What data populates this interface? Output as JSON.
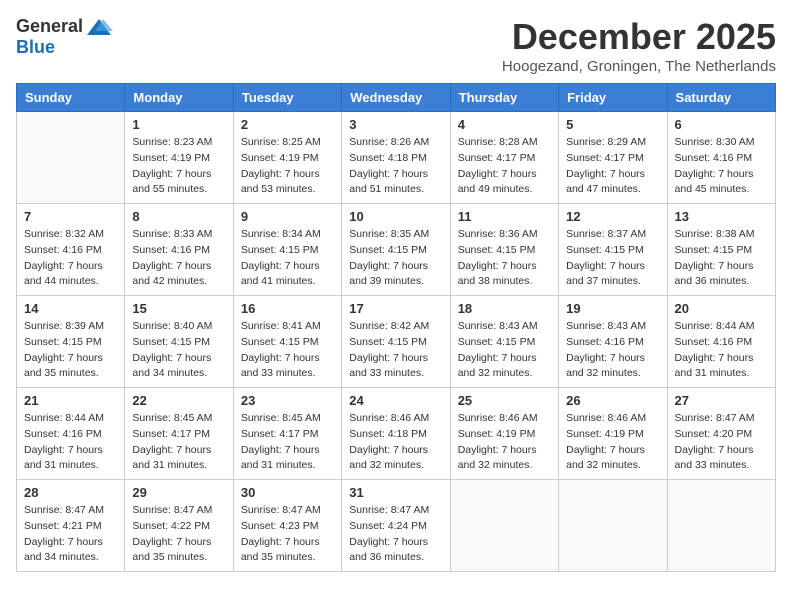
{
  "logo": {
    "general": "General",
    "blue": "Blue"
  },
  "header": {
    "month": "December 2025",
    "location": "Hoogezand, Groningen, The Netherlands"
  },
  "weekdays": [
    "Sunday",
    "Monday",
    "Tuesday",
    "Wednesday",
    "Thursday",
    "Friday",
    "Saturday"
  ],
  "weeks": [
    [
      {
        "day": "",
        "detail": ""
      },
      {
        "day": "1",
        "detail": "Sunrise: 8:23 AM\nSunset: 4:19 PM\nDaylight: 7 hours\nand 55 minutes."
      },
      {
        "day": "2",
        "detail": "Sunrise: 8:25 AM\nSunset: 4:19 PM\nDaylight: 7 hours\nand 53 minutes."
      },
      {
        "day": "3",
        "detail": "Sunrise: 8:26 AM\nSunset: 4:18 PM\nDaylight: 7 hours\nand 51 minutes."
      },
      {
        "day": "4",
        "detail": "Sunrise: 8:28 AM\nSunset: 4:17 PM\nDaylight: 7 hours\nand 49 minutes."
      },
      {
        "day": "5",
        "detail": "Sunrise: 8:29 AM\nSunset: 4:17 PM\nDaylight: 7 hours\nand 47 minutes."
      },
      {
        "day": "6",
        "detail": "Sunrise: 8:30 AM\nSunset: 4:16 PM\nDaylight: 7 hours\nand 45 minutes."
      }
    ],
    [
      {
        "day": "7",
        "detail": "Sunrise: 8:32 AM\nSunset: 4:16 PM\nDaylight: 7 hours\nand 44 minutes."
      },
      {
        "day": "8",
        "detail": "Sunrise: 8:33 AM\nSunset: 4:16 PM\nDaylight: 7 hours\nand 42 minutes."
      },
      {
        "day": "9",
        "detail": "Sunrise: 8:34 AM\nSunset: 4:15 PM\nDaylight: 7 hours\nand 41 minutes."
      },
      {
        "day": "10",
        "detail": "Sunrise: 8:35 AM\nSunset: 4:15 PM\nDaylight: 7 hours\nand 39 minutes."
      },
      {
        "day": "11",
        "detail": "Sunrise: 8:36 AM\nSunset: 4:15 PM\nDaylight: 7 hours\nand 38 minutes."
      },
      {
        "day": "12",
        "detail": "Sunrise: 8:37 AM\nSunset: 4:15 PM\nDaylight: 7 hours\nand 37 minutes."
      },
      {
        "day": "13",
        "detail": "Sunrise: 8:38 AM\nSunset: 4:15 PM\nDaylight: 7 hours\nand 36 minutes."
      }
    ],
    [
      {
        "day": "14",
        "detail": "Sunrise: 8:39 AM\nSunset: 4:15 PM\nDaylight: 7 hours\nand 35 minutes."
      },
      {
        "day": "15",
        "detail": "Sunrise: 8:40 AM\nSunset: 4:15 PM\nDaylight: 7 hours\nand 34 minutes."
      },
      {
        "day": "16",
        "detail": "Sunrise: 8:41 AM\nSunset: 4:15 PM\nDaylight: 7 hours\nand 33 minutes."
      },
      {
        "day": "17",
        "detail": "Sunrise: 8:42 AM\nSunset: 4:15 PM\nDaylight: 7 hours\nand 33 minutes."
      },
      {
        "day": "18",
        "detail": "Sunrise: 8:43 AM\nSunset: 4:15 PM\nDaylight: 7 hours\nand 32 minutes."
      },
      {
        "day": "19",
        "detail": "Sunrise: 8:43 AM\nSunset: 4:16 PM\nDaylight: 7 hours\nand 32 minutes."
      },
      {
        "day": "20",
        "detail": "Sunrise: 8:44 AM\nSunset: 4:16 PM\nDaylight: 7 hours\nand 31 minutes."
      }
    ],
    [
      {
        "day": "21",
        "detail": "Sunrise: 8:44 AM\nSunset: 4:16 PM\nDaylight: 7 hours\nand 31 minutes."
      },
      {
        "day": "22",
        "detail": "Sunrise: 8:45 AM\nSunset: 4:17 PM\nDaylight: 7 hours\nand 31 minutes."
      },
      {
        "day": "23",
        "detail": "Sunrise: 8:45 AM\nSunset: 4:17 PM\nDaylight: 7 hours\nand 31 minutes."
      },
      {
        "day": "24",
        "detail": "Sunrise: 8:46 AM\nSunset: 4:18 PM\nDaylight: 7 hours\nand 32 minutes."
      },
      {
        "day": "25",
        "detail": "Sunrise: 8:46 AM\nSunset: 4:19 PM\nDaylight: 7 hours\nand 32 minutes."
      },
      {
        "day": "26",
        "detail": "Sunrise: 8:46 AM\nSunset: 4:19 PM\nDaylight: 7 hours\nand 32 minutes."
      },
      {
        "day": "27",
        "detail": "Sunrise: 8:47 AM\nSunset: 4:20 PM\nDaylight: 7 hours\nand 33 minutes."
      }
    ],
    [
      {
        "day": "28",
        "detail": "Sunrise: 8:47 AM\nSunset: 4:21 PM\nDaylight: 7 hours\nand 34 minutes."
      },
      {
        "day": "29",
        "detail": "Sunrise: 8:47 AM\nSunset: 4:22 PM\nDaylight: 7 hours\nand 35 minutes."
      },
      {
        "day": "30",
        "detail": "Sunrise: 8:47 AM\nSunset: 4:23 PM\nDaylight: 7 hours\nand 35 minutes."
      },
      {
        "day": "31",
        "detail": "Sunrise: 8:47 AM\nSunset: 4:24 PM\nDaylight: 7 hours\nand 36 minutes."
      },
      {
        "day": "",
        "detail": ""
      },
      {
        "day": "",
        "detail": ""
      },
      {
        "day": "",
        "detail": ""
      }
    ]
  ]
}
